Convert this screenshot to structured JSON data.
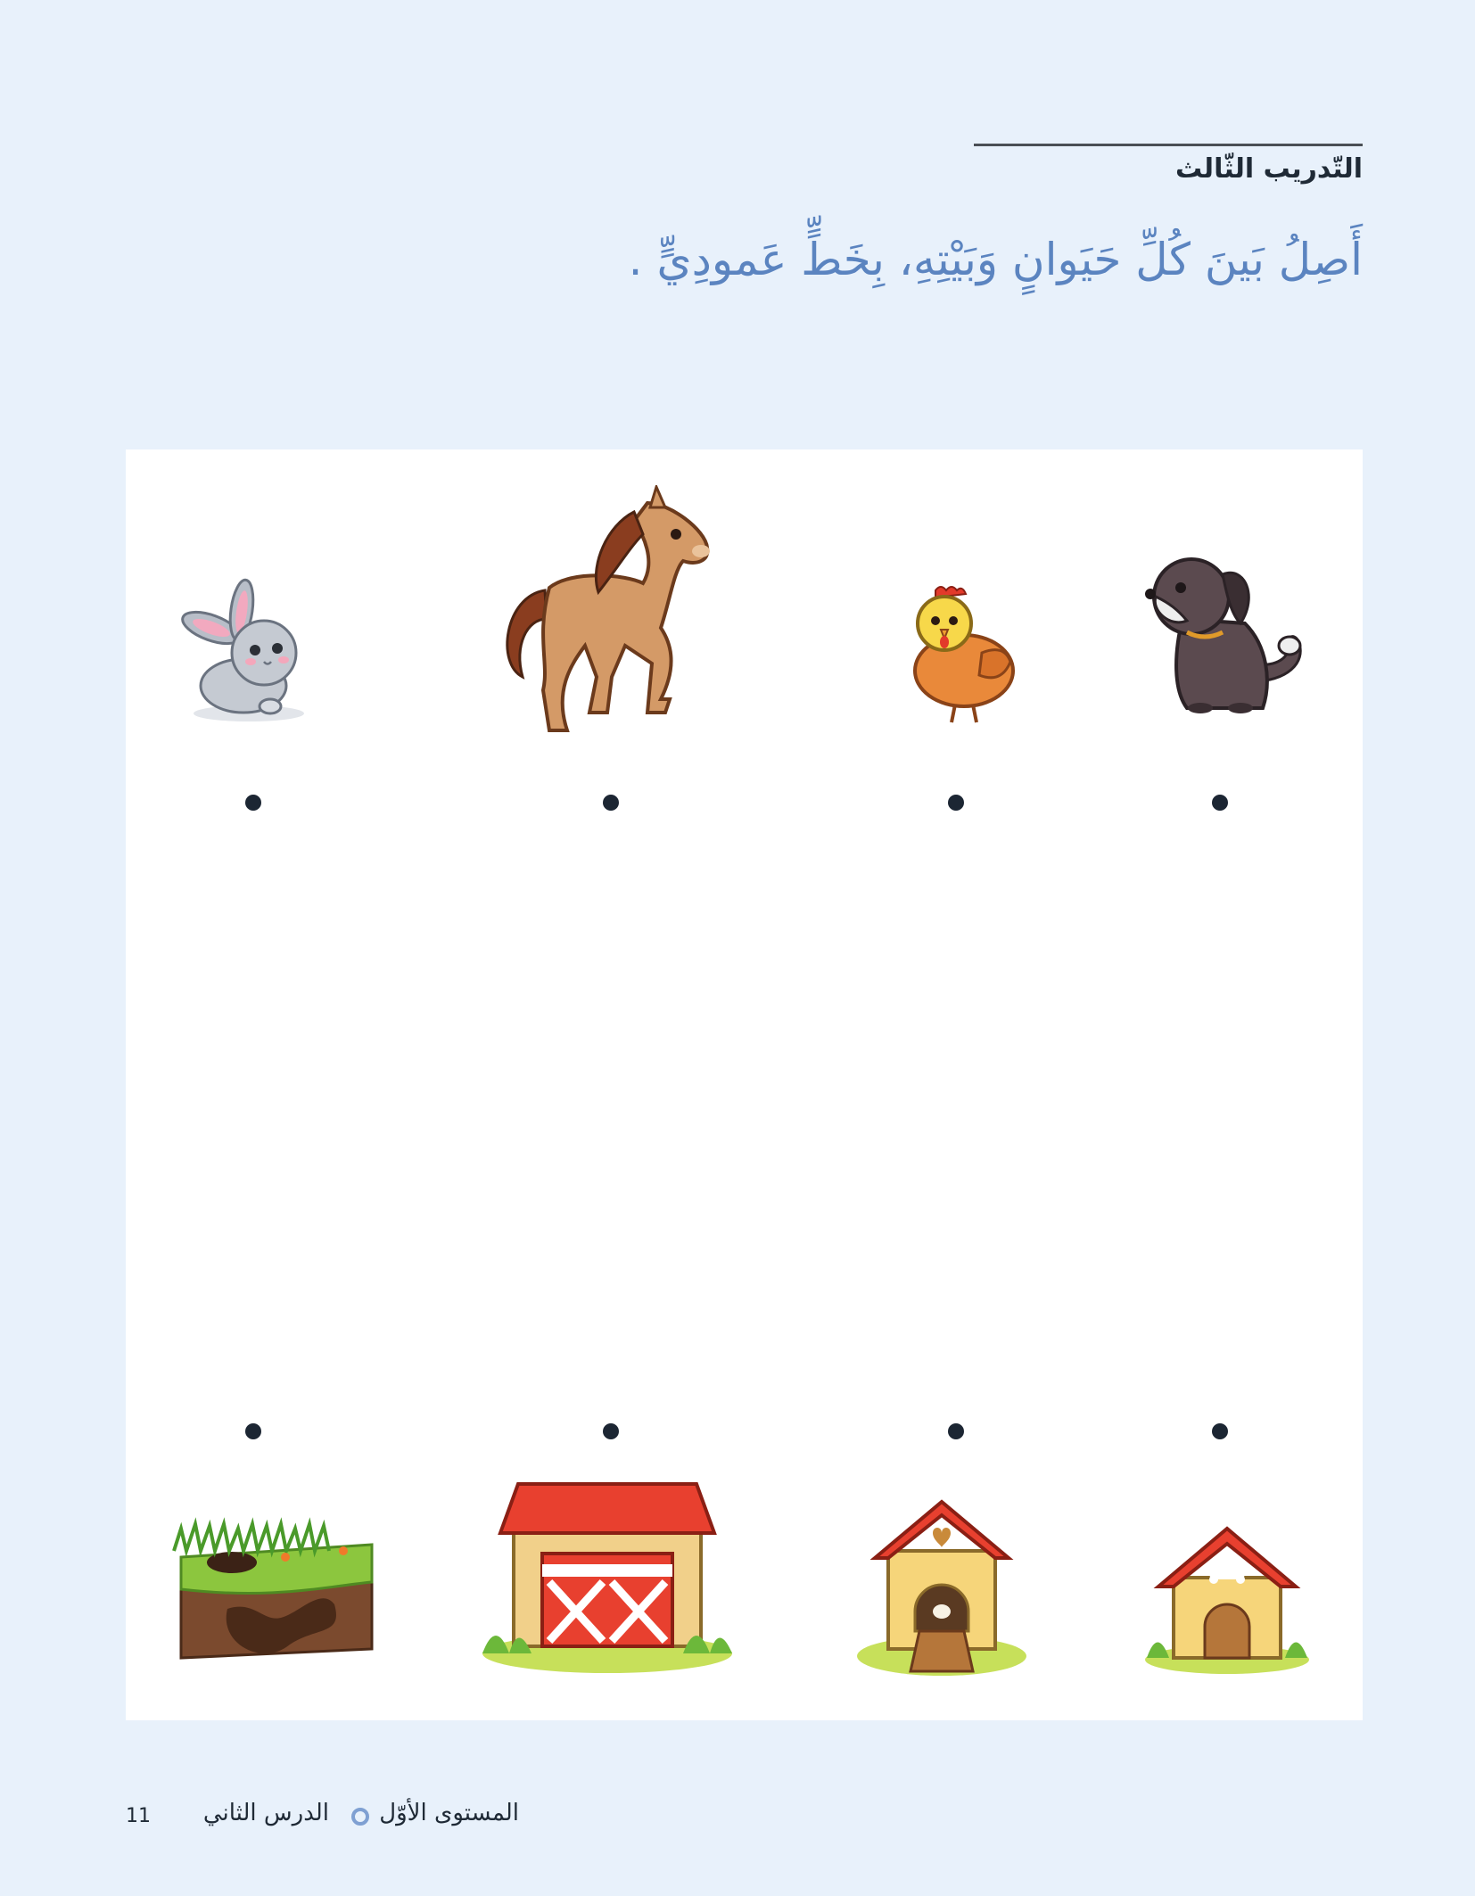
{
  "exercise": {
    "title": "التّدريب الثّالث",
    "instruction": "أَصِلُ بَينَ كُلِّ حَيَوانٍ وَبَيْتِهِ، بِخَطٍّ عَمودِيٍّ ."
  },
  "animals": [
    "rabbit-icon",
    "horse-icon",
    "chicken-icon",
    "dog-icon"
  ],
  "homes": [
    "burrow-icon",
    "barn-icon",
    "chicken-coop-icon",
    "dog-house-icon"
  ],
  "footer": {
    "page_number": "11",
    "lesson": "الدرس الثاني",
    "level": "المستوى الأوّل"
  },
  "colors": {
    "background": "#e8f1fb",
    "instruction": "#5b84c0",
    "dot": "#1c2633",
    "ring": "#7fa0d2"
  }
}
